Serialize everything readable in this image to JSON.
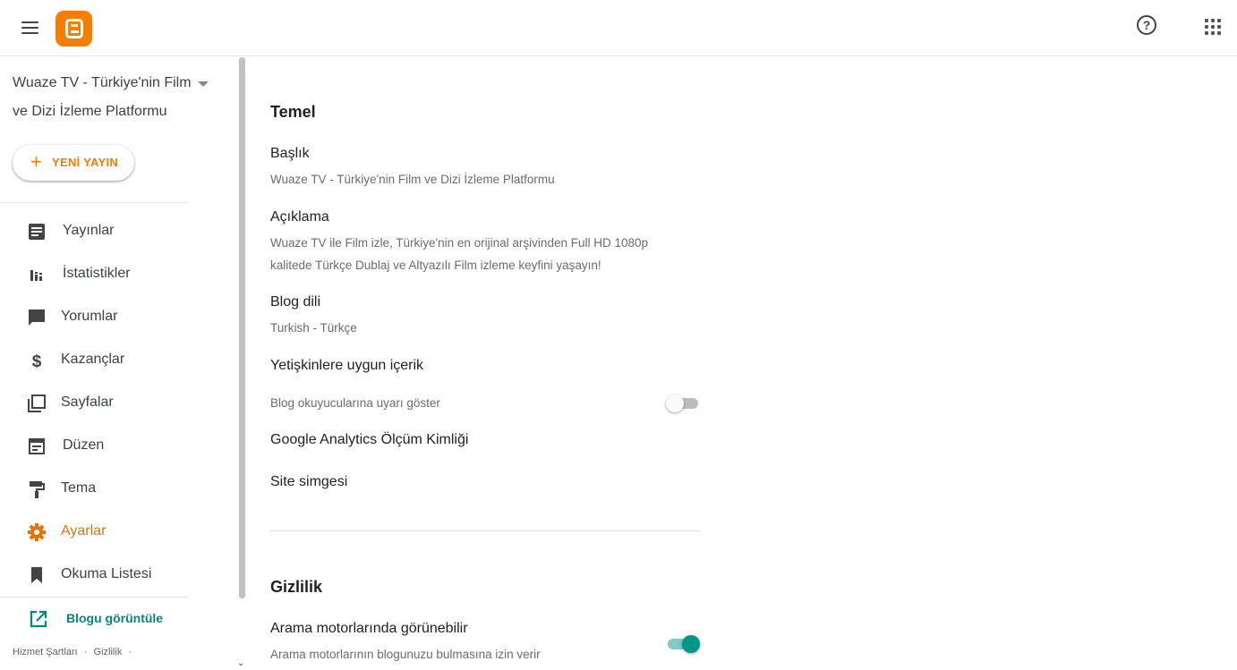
{
  "header": {
    "menu_icon": "hamburger-menu-icon",
    "logo_icon": "blogger-logo-icon",
    "help_glyph": "?",
    "help_icon": "help-circle-icon",
    "apps_icon": "apps-grid-icon"
  },
  "sidebar": {
    "blog_title": "Wuaze TV - Türkiye'nin Film ve Dizi İzleme Platformu",
    "new_post_label": "YENİ YAYIN",
    "items": [
      {
        "label": "Yayınlar",
        "icon": "posts-icon"
      },
      {
        "label": "İstatistikler",
        "icon": "stats-icon"
      },
      {
        "label": "Yorumlar",
        "icon": "comments-icon"
      },
      {
        "label": "Kazançlar",
        "icon": "dollar-icon"
      },
      {
        "label": "Sayfalar",
        "icon": "pages-icon"
      },
      {
        "label": "Düzen",
        "icon": "layout-icon"
      },
      {
        "label": "Tema",
        "icon": "paint-roller-icon"
      },
      {
        "label": "Ayarlar",
        "icon": "gear-icon"
      },
      {
        "label": "Okuma Listesi",
        "icon": "bookmark-icon"
      }
    ],
    "view_blog_label": "Blogu görüntüle",
    "footer_terms": "Hizmet Şartları",
    "footer_sep": "·",
    "footer_privacy": "Gizlilik",
    "footer_sep2": "·"
  },
  "main": {
    "basic": {
      "title": "Temel",
      "blog_title_label": "Başlık",
      "blog_title_value": "Wuaze TV - Türkiye'nin Film ve Dizi İzleme Platformu",
      "description_label": "Açıklama",
      "description_value": "Wuaze TV ile Film izle, Türkiye'nin en orijinal arşivinden Full HD 1080p kalitede Türkçe Dublaj ve Altyazılı Film izleme keyfini yaşayın!",
      "language_label": "Blog dili",
      "language_value": "Turkish - Türkçe",
      "adult_label": "Yetişkinlere uygun içerik",
      "adult_value": "Blog okuyucularına uyarı göster",
      "adult_enabled": false,
      "analytics_label": "Google Analytics Ölçüm Kimliği",
      "favicon_label": "Site simgesi"
    },
    "privacy": {
      "title": "Gizlilik",
      "search_label": "Arama motorlarında görünebilir",
      "search_value": "Arama motorlarının blogunuzu bulmasına izin verir",
      "search_enabled": true
    }
  },
  "colors": {
    "accent": "#f57d00",
    "active_nav": "#e8710a",
    "teal": "#009688",
    "link": "#00897b"
  }
}
